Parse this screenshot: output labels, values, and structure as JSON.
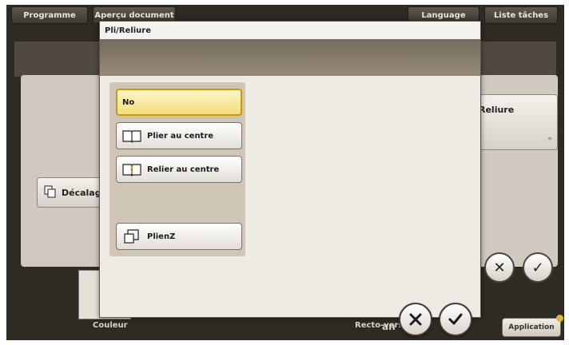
{
  "topbar": {
    "programme": "Programme",
    "apercu": "Aperçu document",
    "language": "Language",
    "tasks": "Liste tâches"
  },
  "background": {
    "decalage_label": "Décalag",
    "reliure_label": "Reliure",
    "reliure_chevron": "»",
    "couleur_label": "Couleur",
    "recto_label": "Recto-vers",
    "application_label": "Application",
    "partial_right_label": "an"
  },
  "dialog": {
    "title": "Pli/Reliure",
    "options": [
      {
        "label": "No",
        "selected": true
      },
      {
        "label": "Plier au centre",
        "icon": "open-book-icon",
        "selected": false
      },
      {
        "label": "Relier au centre",
        "icon": "stapled-book-icon",
        "selected": false
      },
      {
        "label": "PlienZ",
        "icon": "z-fold-icon",
        "selected": false
      }
    ]
  },
  "colors": {
    "accent_selected": "#f3dd7a",
    "frame": "#2e2a24",
    "band": "#857a6b"
  }
}
